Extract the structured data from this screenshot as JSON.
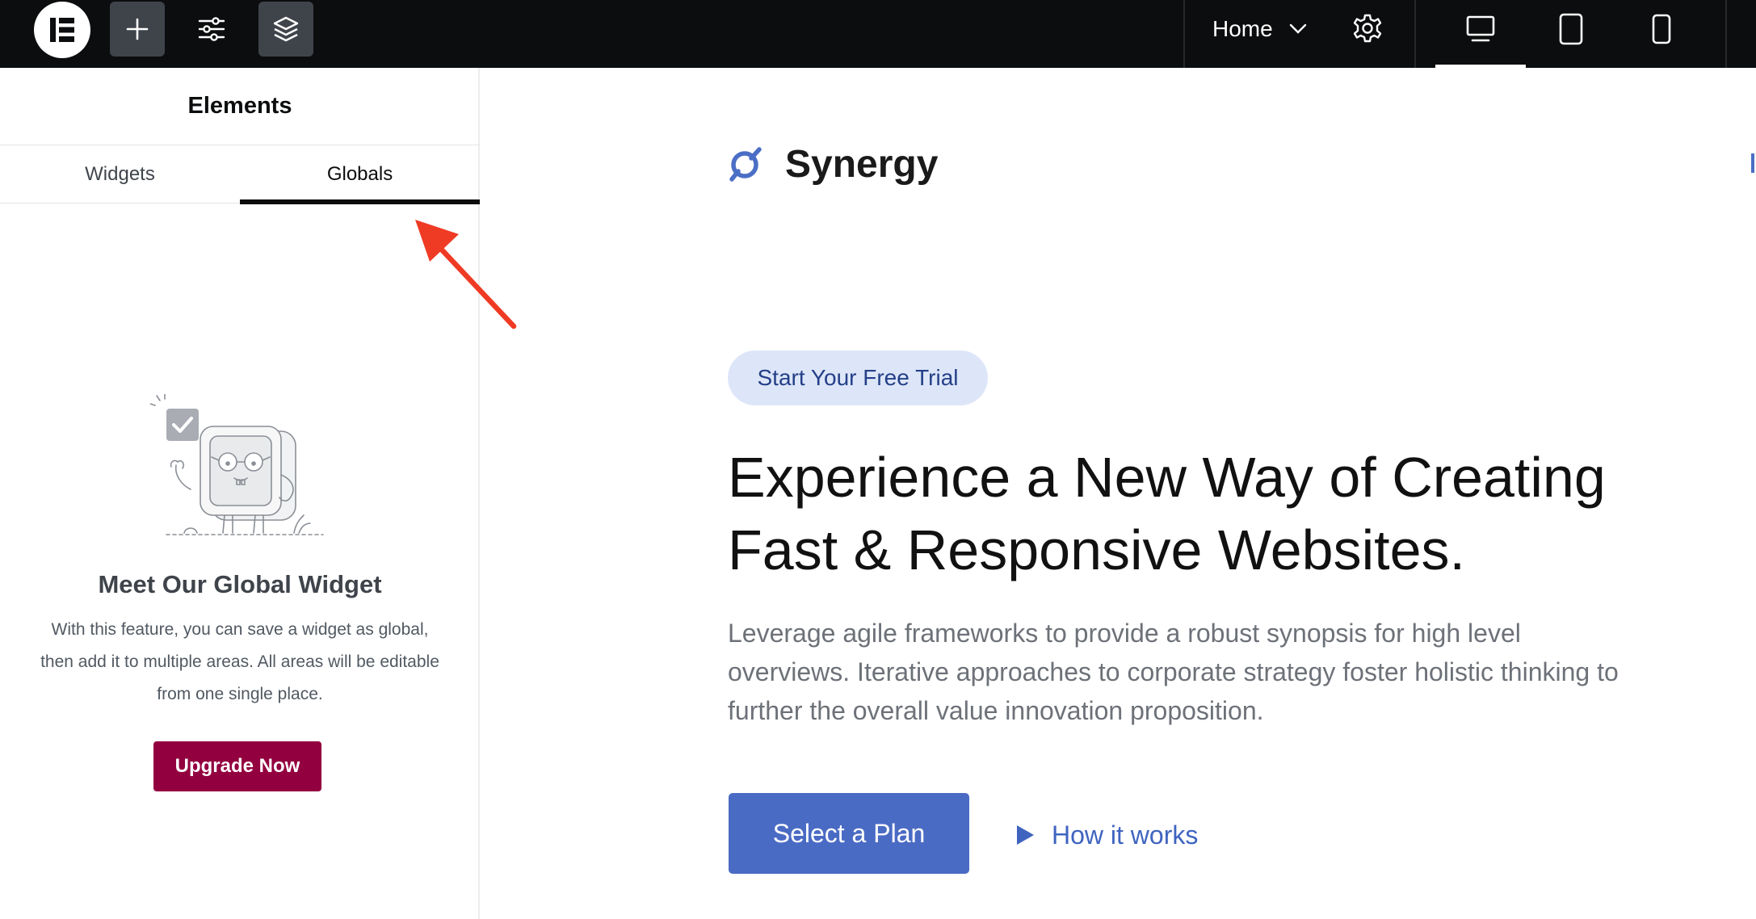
{
  "topbar": {
    "page_name": "Home",
    "icons": [
      "elementor-logo-icon",
      "add-icon",
      "site-settings-sliders-icon",
      "structure-layers-icon",
      "chevron-down-icon",
      "gear-icon",
      "desktop-icon",
      "tablet-icon",
      "mobile-icon"
    ],
    "active_device": "desktop"
  },
  "panel": {
    "title": "Elements",
    "tabs": [
      {
        "label": "Widgets",
        "active": false
      },
      {
        "label": "Globals",
        "active": true
      }
    ],
    "promo": {
      "title": "Meet Our Global Widget",
      "description": "With this feature, you can save a widget as global, then add it to multiple areas. All areas will be editable from one single place.",
      "button_label": "Upgrade Now"
    }
  },
  "canvas": {
    "brand_name": "Synergy",
    "pill_label": "Start Your Free Trial",
    "headline_line1": "Experience a New Way of Creating",
    "headline_line2": "Fast & Responsive Websites.",
    "paragraph_line1": "Leverage agile frameworks to provide a robust synopsis for high level",
    "paragraph_line2": "overviews. Iterative approaches to corporate strategy foster holistic thinking to",
    "paragraph_line3": "further the overall value innovation proposition.",
    "primary_button_label": "Select a Plan",
    "secondary_link_label": "How it works"
  },
  "colors": {
    "topbar_bg": "#0c0d0e",
    "upgrade_button": "#93003f",
    "primary_button": "#4a6bc4",
    "pill_bg": "#dde6f8",
    "link": "#3f64c0",
    "annotation_arrow": "#ef3b24"
  }
}
